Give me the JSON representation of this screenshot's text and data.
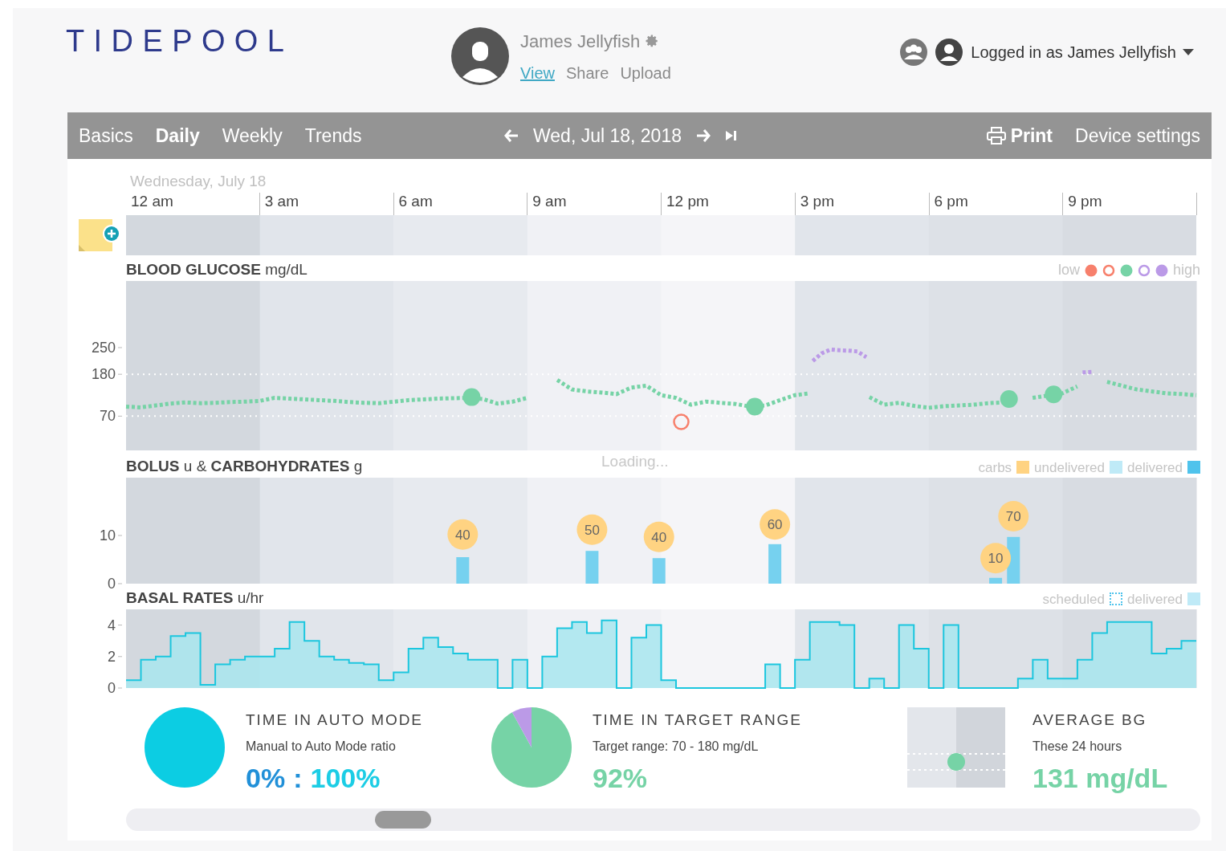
{
  "logo": "TIDEPOOL",
  "patient": {
    "name": "James Jellyfish",
    "links": [
      {
        "label": "View",
        "selected": true
      },
      {
        "label": "Share",
        "selected": false
      },
      {
        "label": "Upload",
        "selected": false
      }
    ]
  },
  "account": {
    "label": "Logged in as James Jellyfish"
  },
  "nav": {
    "tabs": [
      {
        "label": "Basics",
        "selected": false
      },
      {
        "label": "Daily",
        "selected": true
      },
      {
        "label": "Weekly",
        "selected": false
      },
      {
        "label": "Trends",
        "selected": false
      }
    ],
    "date": "Wed, Jul 18, 2018",
    "print": "Print",
    "device_settings": "Device settings"
  },
  "day_label": "Wednesday, July 18",
  "hours": [
    "12 am",
    "3 am",
    "6 am",
    "9 am",
    "12 pm",
    "3 pm",
    "6 pm",
    "9 pm"
  ],
  "blood_glucose": {
    "title": "BLOOD GLUCOSE",
    "unit": "mg/dL",
    "legend_low": "low",
    "legend_high": "high",
    "legend": [
      {
        "kind": "dot",
        "color": "#f7806c"
      },
      {
        "kind": "ring",
        "color": "#f7806c"
      },
      {
        "kind": "dot",
        "color": "#76d3a6"
      },
      {
        "kind": "ring",
        "color": "#bb9ae7"
      },
      {
        "kind": "dot",
        "color": "#bb9ae7"
      }
    ],
    "y_ticks": [
      "250",
      "180",
      "70"
    ]
  },
  "loading_text": "Loading...",
  "bolus": {
    "title": "BOLUS",
    "unit_1": "u &",
    "title_2": "CARBOHYDRATES",
    "unit_2": "g",
    "legend": [
      {
        "label": "carbs",
        "kind": "solid",
        "color": "#ffd382"
      },
      {
        "label": "undelivered",
        "kind": "solid",
        "color": "#bfeaf7"
      },
      {
        "label": "delivered",
        "kind": "solid",
        "color": "#4fc3ec"
      }
    ],
    "y_ticks": [
      "10",
      "0"
    ],
    "carbs": [
      "40",
      "50",
      "40",
      "60",
      "10",
      "70"
    ]
  },
  "basal": {
    "title": "BASAL RATES",
    "unit": "u/hr",
    "legend": [
      {
        "label": "scheduled",
        "kind": "dashed",
        "color": "#4fc3ec"
      },
      {
        "label": "delivered",
        "kind": "solid",
        "color": "#bfeaf7"
      }
    ],
    "y_ticks": [
      "4",
      "2",
      "0"
    ]
  },
  "stats": [
    {
      "title": "TIME IN AUTO MODE",
      "subtitle": "Manual to Auto Mode ratio",
      "value_parts": [
        {
          "text": "0%",
          "color": "#2190d8"
        },
        {
          "text": ":",
          "color": "#2190d8"
        },
        {
          "text": "100%",
          "color": "#1ccde5"
        }
      ],
      "chart_data": {
        "type": "pie",
        "values": [
          0,
          100
        ],
        "colors": [
          "#2190d8",
          "#0ccde3"
        ]
      }
    },
    {
      "title": "TIME IN TARGET RANGE",
      "subtitle": "Target range: 70 - 180 mg/dL",
      "value_parts": [
        {
          "text": "92%",
          "color": "#76d3a6"
        }
      ],
      "chart_data": {
        "type": "pie",
        "values": [
          92,
          8
        ],
        "colors": [
          "#76d3a6",
          "#bb9ae7"
        ]
      }
    },
    {
      "title": "AVERAGE BG",
      "subtitle": "These 24 hours",
      "value_parts": [
        {
          "text": "131 mg/dL",
          "color": "#76d3a6"
        }
      ]
    }
  ]
}
